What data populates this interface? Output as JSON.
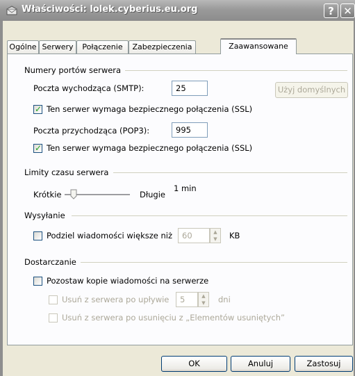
{
  "window": {
    "title": "Właściwości: lolek.cyberius.eu.org",
    "help_glyph": "?",
    "close_glyph": "✕"
  },
  "tabs": [
    {
      "label": "Ogólne"
    },
    {
      "label": "Serwery"
    },
    {
      "label": "Połączenie"
    },
    {
      "label": "Zabezpieczenia"
    },
    {
      "label": "Zaawansowane",
      "active": true
    }
  ],
  "ports": {
    "group_label": "Numery portów serwera",
    "smtp_label": "Poczta wychodząca (SMTP):",
    "smtp_value": "25",
    "default_button": "Użyj domyślnych",
    "smtp_ssl_label": "Ten serwer wymaga bezpiecznego połączenia (SSL)",
    "smtp_ssl_checked": true,
    "pop3_label": "Poczta przychodząca (POP3):",
    "pop3_value": "995",
    "pop3_ssl_label": "Ten serwer wymaga bezpiecznego połączenia (SSL)",
    "pop3_ssl_checked": true
  },
  "timeouts": {
    "group_label": "Limity czasu serwera",
    "short_label": "Krótkie",
    "long_label": "Długie",
    "value_label": "1 min",
    "level": 0.1
  },
  "sending": {
    "group_label": "Wysyłanie",
    "split_label": "Podziel wiadomości większe niż",
    "split_checked": false,
    "split_value": "60",
    "unit": "KB"
  },
  "delivery": {
    "group_label": "Dostarczanie",
    "keep_copy_label": "Pozostaw kopie wiadomości na serwerze",
    "keep_copy_checked": false,
    "remove_after_label": "Usuń z serwera po upływie",
    "remove_after_value": "5",
    "days_label": "dni",
    "remove_deleted_label": "Usuń z serwera po usunięciu z „Elementów usuniętych”"
  },
  "buttons": {
    "ok": "OK",
    "cancel": "Anuluj",
    "apply": "Zastosuj"
  }
}
